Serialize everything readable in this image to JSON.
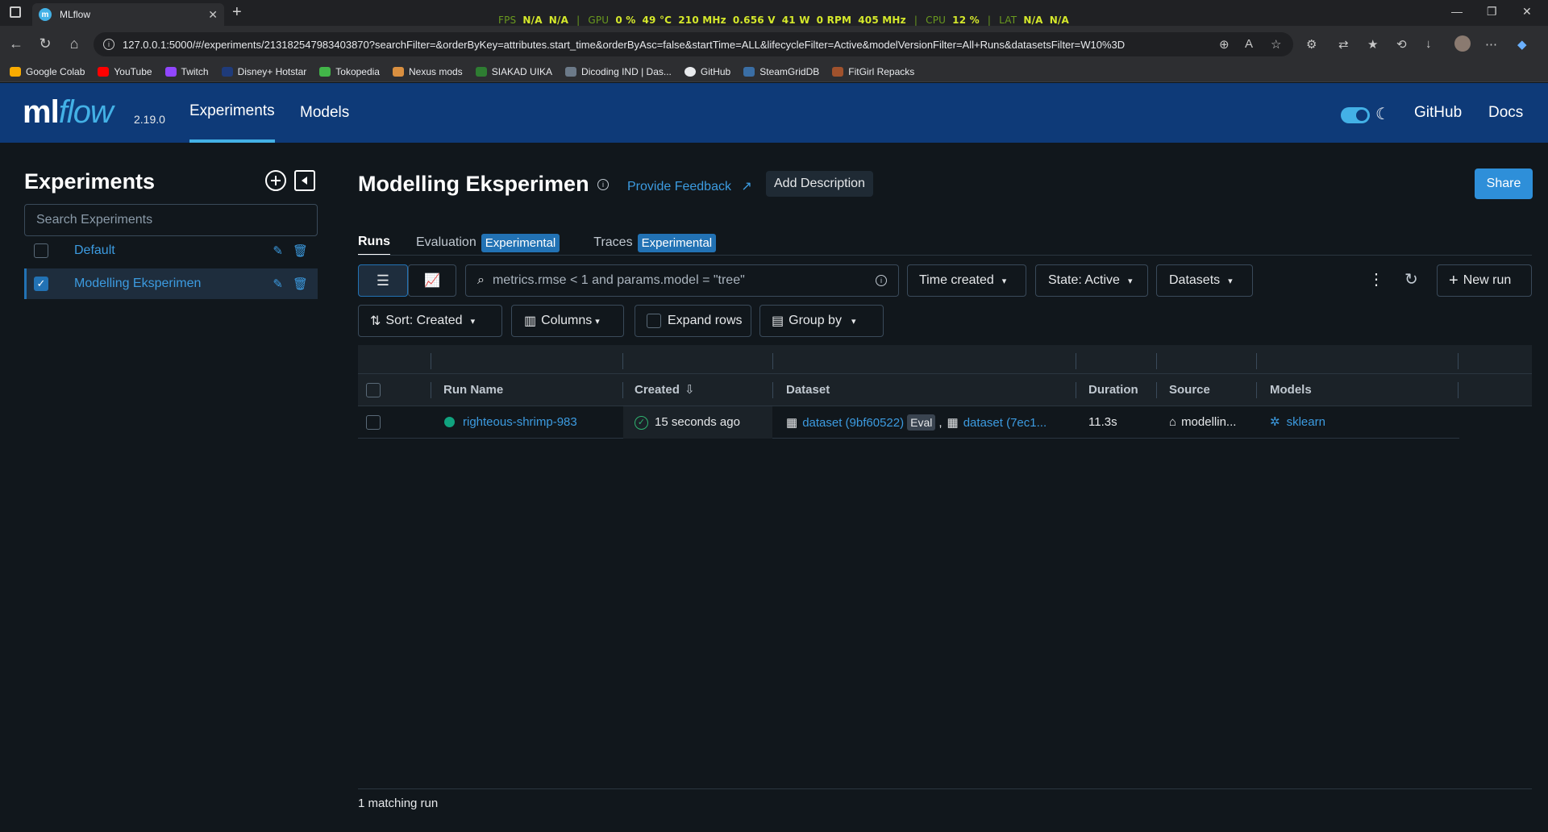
{
  "browser": {
    "tab_title": "MLflow",
    "url": "127.0.0.1:5000/#/experiments/213182547983403870?searchFilter=&orderByKey=attributes.start_time&orderByAsc=false&startTime=ALL&lifecycleFilter=Active&modelVersionFilter=All+Runs&datasetsFilter=W10%3D",
    "bookmarks": [
      "Google Colab",
      "YouTube",
      "Twitch",
      "Disney+ Hotstar",
      "Tokopedia",
      "Nexus mods",
      "SIAKAD UIKA",
      "Dicoding IND | Das...",
      "GitHub",
      "SteamGridDB",
      "FitGirl Repacks"
    ]
  },
  "overlay": {
    "fps_label": "FPS",
    "fps_val1": "N/A",
    "fps_val2": "N/A",
    "gpu_label": "GPU",
    "gpu_load": "0 %",
    "gpu_temp": "49 °C",
    "gpu_clock": "210 MHz",
    "gpu_volt": "0.656 V",
    "gpu_power": "41 W",
    "gpu_fan": "0 RPM",
    "gpu_mem": "405 MHz",
    "cpu_label": "CPU",
    "cpu_load": "12 %",
    "lat_label": "LAT",
    "lat_val1": "N/A",
    "lat_val2": "N/A"
  },
  "header": {
    "logo_ml": "ml",
    "logo_flow": "flow",
    "version": "2.19.0",
    "nav_experiments": "Experiments",
    "nav_models": "Models",
    "github": "GitHub",
    "docs": "Docs"
  },
  "sidebar": {
    "title": "Experiments",
    "search_placeholder": "Search Experiments",
    "experiments": [
      {
        "name": "Default",
        "selected": false
      },
      {
        "name": "Modelling Eksperimen",
        "selected": true
      }
    ]
  },
  "main": {
    "title": "Modelling Eksperimen",
    "feedback": "Provide Feedback",
    "add_description": "Add Description",
    "share": "Share",
    "tabs": [
      {
        "label": "Runs",
        "badge": ""
      },
      {
        "label": "Evaluation",
        "badge": "Experimental"
      },
      {
        "label": "Traces",
        "badge": "Experimental"
      }
    ],
    "search_placeholder": "metrics.rmse < 1 and params.model = \"tree\"",
    "time_created": "Time created",
    "state": "State: Active",
    "datasets": "Datasets",
    "new_run": "New run",
    "sort": "Sort: Created",
    "columns": "Columns",
    "expand_rows": "Expand rows",
    "group_by": "Group by"
  },
  "table": {
    "headers": [
      "Run Name",
      "Created",
      "Dataset",
      "Duration",
      "Source",
      "Models"
    ],
    "rows": [
      {
        "run_name": "righteous-shrimp-983",
        "created": "15 seconds ago",
        "dataset1": "dataset (9bf60522)",
        "dataset_badge": "Eval",
        "dataset_sep": ",",
        "dataset2": "dataset (7ec1...",
        "duration": "11.3s",
        "source": "modellin...",
        "model": "sklearn"
      }
    ]
  },
  "footer": {
    "matching": "1 matching run"
  },
  "colors": {
    "header_bg": "#0e3a78",
    "accent": "#43b1e6",
    "link": "#3c9be0",
    "primary_button": "#2e8fd9",
    "status_green": "#10a37f"
  }
}
